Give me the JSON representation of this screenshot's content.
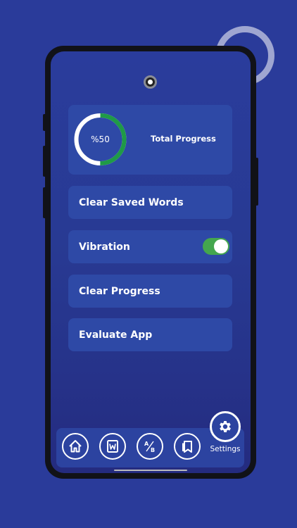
{
  "progress": {
    "percent_label": "%50",
    "value": 0.5,
    "title": "Total Progress",
    "fill_color": "#1f9a47",
    "track_color": "#ffffff"
  },
  "menu": {
    "clear_saved_words": "Clear Saved Words",
    "vibration": "Vibration",
    "vibration_on": true,
    "clear_progress": "Clear Progress",
    "evaluate_app": "Evaluate App"
  },
  "nav": {
    "items": [
      {
        "icon": "home-icon"
      },
      {
        "icon": "word-icon"
      },
      {
        "icon": "a-b-icon"
      },
      {
        "icon": "bookmarks-icon"
      }
    ],
    "settings_label": "Settings",
    "settings_icon": "gear-icon"
  },
  "colors": {
    "background": "#2a3b9a",
    "card": "#2e49a6",
    "toggle_on": "#44a64e"
  }
}
